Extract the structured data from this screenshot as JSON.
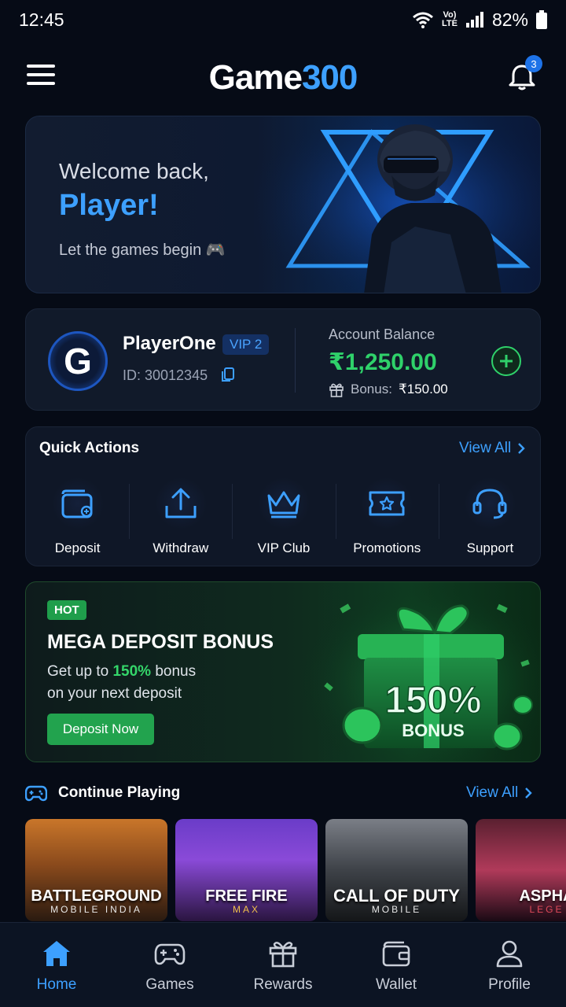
{
  "status_bar": {
    "time": "12:45",
    "network": "Vo) LTE",
    "battery": "82%"
  },
  "header": {
    "logo_part1": "Game",
    "logo_part2": "300",
    "notification_count": "3"
  },
  "hero": {
    "greeting": "Welcome back,",
    "name": "Player!",
    "subtitle": "Let the games begin 🎮"
  },
  "account": {
    "avatar_letter": "G",
    "username": "PlayerOne",
    "vip": "VIP 2",
    "id": "ID: 30012345",
    "balance_label": "Account Balance",
    "balance": "₹1,250.00",
    "bonus_label": "Bonus:",
    "bonus_value": "₹150.00"
  },
  "quick_actions": {
    "title": "Quick Actions",
    "view_all": "View All",
    "items": [
      {
        "label": "Deposit",
        "icon": "wallet-plus-icon"
      },
      {
        "label": "Withdraw",
        "icon": "upload-icon"
      },
      {
        "label": "VIP Club",
        "icon": "crown-icon"
      },
      {
        "label": "Promotions",
        "icon": "ticket-star-icon"
      },
      {
        "label": "Support",
        "icon": "headset-icon"
      }
    ]
  },
  "promo": {
    "badge": "HOT",
    "title": "MEGA DEPOSIT BONUS",
    "desc_pre": "Get up to",
    "desc_highlight": "150%",
    "desc_post": "bonus",
    "desc_line2": "on your next deposit",
    "button": "Deposit Now",
    "art_value": "150%",
    "art_label": "BONUS"
  },
  "continue_playing": {
    "title": "Continue Playing",
    "view_all": "View All",
    "games": [
      {
        "name": "BATTLEGROUND",
        "sub": "MOBILE INDIA"
      },
      {
        "name": "FREE FIRE",
        "sub": "MAX"
      },
      {
        "name": "CALL OF DUTY",
        "sub": "MOBILE"
      },
      {
        "name": "ASPHA",
        "sub": "LEGE"
      }
    ]
  },
  "bottom_nav": {
    "items": [
      {
        "label": "Home",
        "icon": "home-icon",
        "active": true
      },
      {
        "label": "Games",
        "icon": "gamepad-icon"
      },
      {
        "label": "Rewards",
        "icon": "gift-icon"
      },
      {
        "label": "Wallet",
        "icon": "wallet-icon"
      },
      {
        "label": "Profile",
        "icon": "user-icon"
      }
    ]
  },
  "colors": {
    "accent": "#3da0ff",
    "money": "#2fd16a",
    "background": "#060b16"
  }
}
